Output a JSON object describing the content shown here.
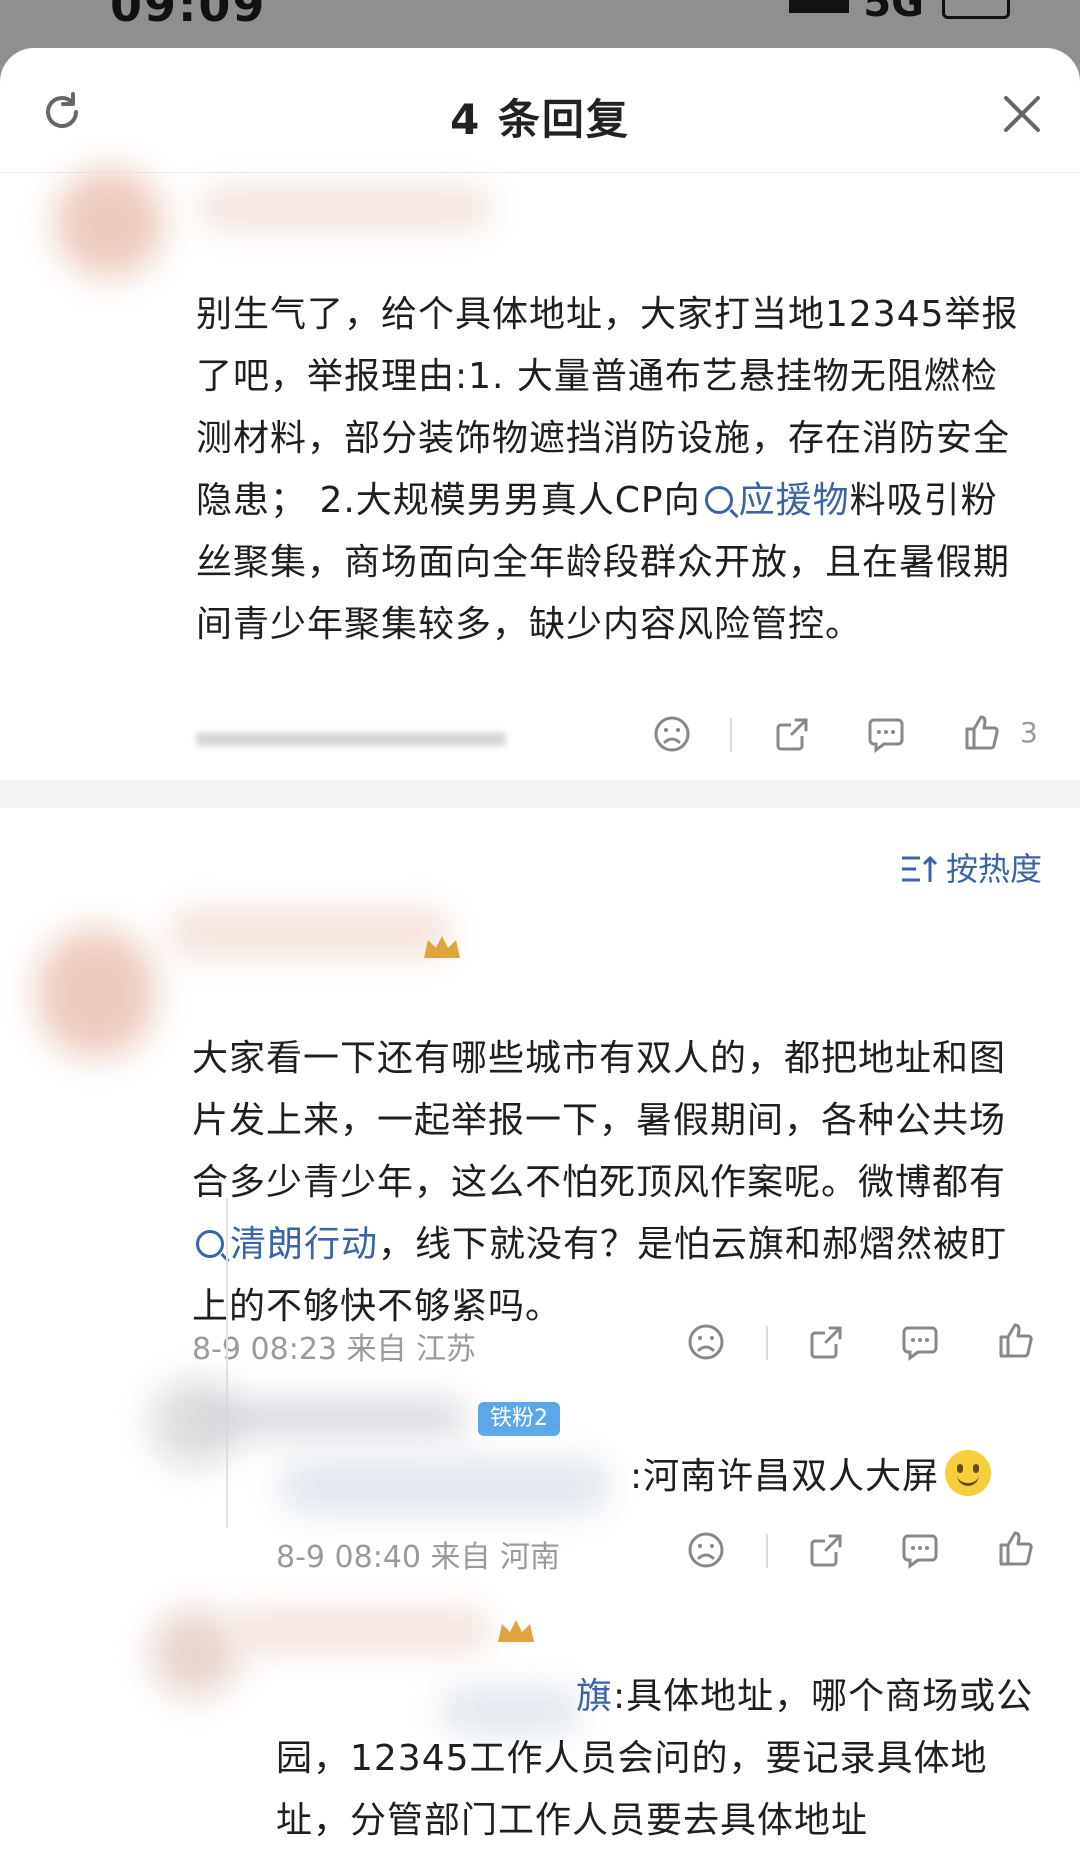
{
  "header": {
    "title": "4 条回复"
  },
  "root_comment": {
    "text": "别生气了，给个具体地址，大家打当地12345举报了吧，举报理由:1. 大量普通布艺悬挂物无阻燃检测材料，部分装饰物遮挡消防设施，存在消防安全隐患； 2.大规模男男真人CP向",
    "link": "应援物",
    "text_after": "料吸引粉丝聚集，商场面向全年龄段群众开放，且在暑假期间青少年聚集较多，缺少内容风险管控。",
    "like_count": "3"
  },
  "sort": {
    "label": "按热度"
  },
  "reply1": {
    "text": "大家看一下还有哪些城市有双人的，都把地址和图片发上来，一起举报一下，暑假期间，各种公共场合多少青少年，这么不怕死顶风作案呢。微博都有",
    "link": "清朗行动",
    "text_after": "，线下就没有？是怕云旗和郝熠然被盯上的不够快不够紧吗。",
    "meta": "8-9 08:23 来自 江苏"
  },
  "sub_reply1": {
    "badge": "铁粉2",
    "text": ":河南许昌双人大屏",
    "meta": "8-9 08:40 来自 河南"
  },
  "sub_reply2": {
    "text_prefix": "旗",
    "text": ":具体地址，哪个商场或公园，12345工作人员会问的，要记录具体地址，分管部门工作人员要去具体地址"
  }
}
